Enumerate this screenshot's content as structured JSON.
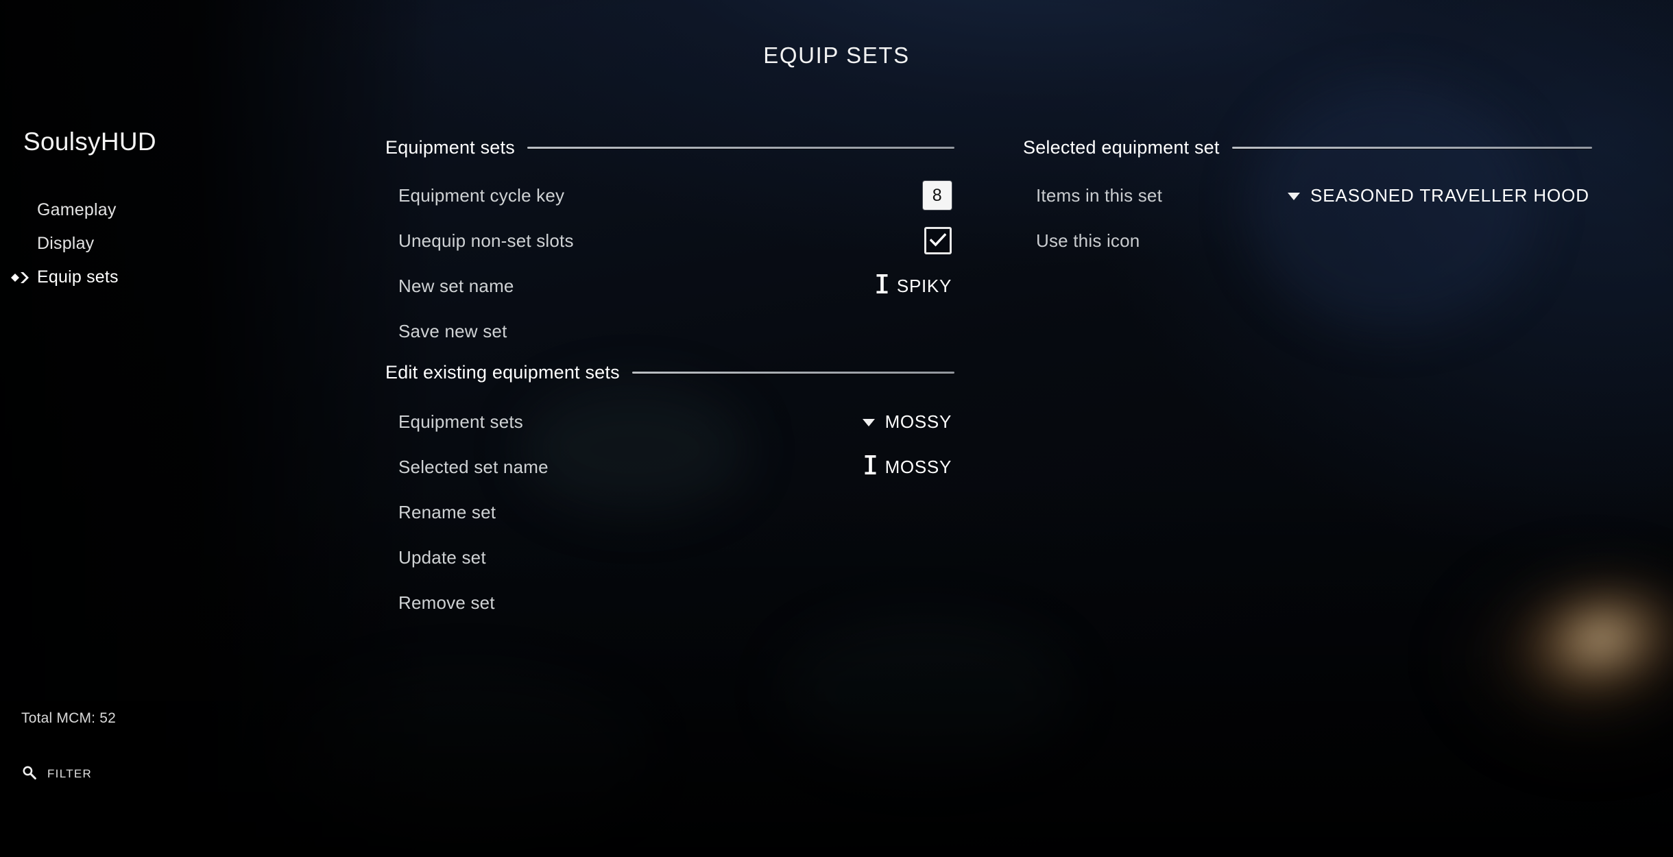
{
  "page": {
    "title": "EQUIP SETS",
    "background_color": "#05070a",
    "accent_color": "#c4c8cd",
    "glow_color": "#ffe2b6"
  },
  "sidebar": {
    "mod_title": "SoulsyHUD",
    "items": [
      {
        "label": "Gameplay",
        "selected": false
      },
      {
        "label": "Display",
        "selected": false
      },
      {
        "label": "Equip sets",
        "selected": true
      }
    ],
    "total_mcm": "Total MCM: 52",
    "filter": {
      "icon": "search-icon",
      "label": "FILTER"
    },
    "selection_marker_icon": "chevron-right-icon"
  },
  "middle_column": {
    "sections": [
      {
        "header": "Equipment sets",
        "rows": [
          {
            "label": "Equipment cycle key",
            "control": "key-badge",
            "value": "8",
            "icon": ""
          },
          {
            "label": "Unequip non-set slots",
            "control": "checkbox",
            "value": "",
            "checked": true,
            "icon": "checkmark-icon"
          },
          {
            "label": "New set name",
            "control": "text-input",
            "value": "SPIKY",
            "icon": "text-cursor-icon"
          },
          {
            "label": "Save new set",
            "control": "action",
            "value": "",
            "icon": ""
          }
        ]
      },
      {
        "header": "Edit existing equipment sets",
        "rows": [
          {
            "label": "Equipment sets",
            "control": "dropdown",
            "value": "MOSSY",
            "icon": "chevron-down-icon"
          },
          {
            "label": "Selected set name",
            "control": "text-input",
            "value": "MOSSY",
            "icon": "text-cursor-icon"
          },
          {
            "label": "Rename set",
            "control": "action",
            "value": "",
            "icon": ""
          },
          {
            "label": "Update set",
            "control": "action",
            "value": "",
            "icon": ""
          },
          {
            "label": "Remove set",
            "control": "action",
            "value": "",
            "icon": ""
          }
        ]
      }
    ]
  },
  "right_column": {
    "sections": [
      {
        "header": "Selected equipment set",
        "rows": [
          {
            "label": "Items in this set",
            "control": "dropdown",
            "value": "SEASONED TRAVELLER HOOD",
            "icon": "chevron-down-icon"
          },
          {
            "label": "Use this icon",
            "control": "action",
            "value": "",
            "icon": ""
          }
        ]
      }
    ]
  }
}
